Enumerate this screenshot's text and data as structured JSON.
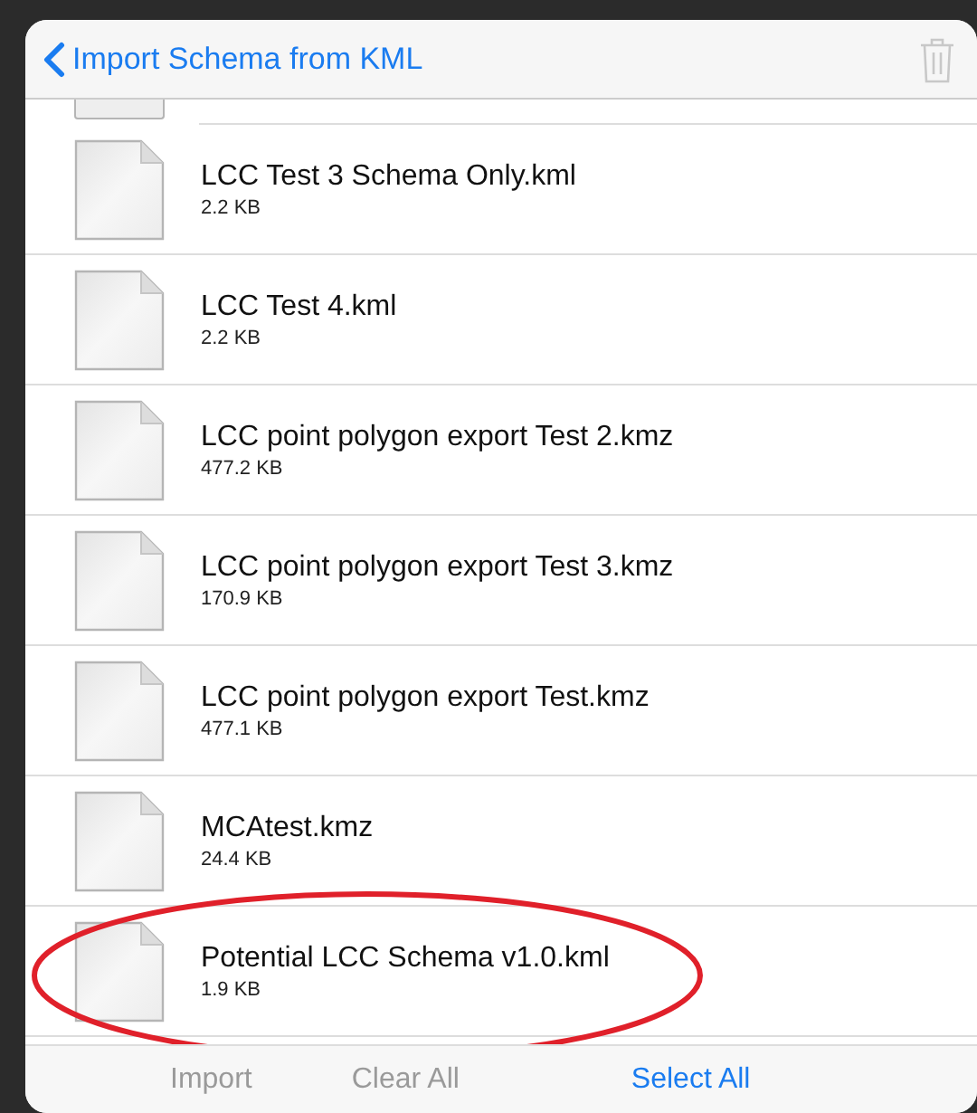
{
  "header": {
    "back_title": "Import Schema from KML",
    "trash_disabled": true
  },
  "files": [
    {
      "name": "LCC Test 3 Schema Only.kml",
      "size": "2.2 KB",
      "circled": false
    },
    {
      "name": "LCC Test 4.kml",
      "size": "2.2 KB",
      "circled": false
    },
    {
      "name": "LCC point polygon export Test 2.kmz",
      "size": "477.2 KB",
      "circled": false
    },
    {
      "name": "LCC point polygon export Test 3.kmz",
      "size": "170.9 KB",
      "circled": false
    },
    {
      "name": "LCC point polygon export Test.kmz",
      "size": "477.1 KB",
      "circled": false
    },
    {
      "name": "MCAtest.kmz",
      "size": "24.4 KB",
      "circled": false
    },
    {
      "name": "Potential LCC Schema v1.0.kml",
      "size": "1.9 KB",
      "circled": true
    }
  ],
  "toolbar": [
    {
      "label": "Import",
      "disabled": true
    },
    {
      "label": "Clear All",
      "disabled": true
    },
    {
      "label": "Select All",
      "disabled": false
    }
  ]
}
